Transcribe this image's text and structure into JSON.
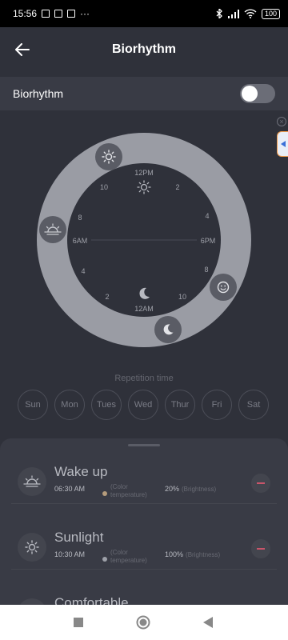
{
  "status_bar": {
    "time": "15:56",
    "extra": "···",
    "battery": "100"
  },
  "header": {
    "title": "Biorhythm"
  },
  "biorhythm_toggle": {
    "label": "Biorhythm",
    "on": false
  },
  "dial": {
    "top_label": "12PM",
    "bottom_label": "12AM",
    "left_label": "6AM",
    "right_label": "6PM",
    "hour_left_top": "10",
    "hour_right_top": "2",
    "hour_left_mid": "8",
    "hour_right_mid": "4",
    "hour_left_low": "4",
    "hour_right_low": "8",
    "hour_left_bottom": "2",
    "hour_right_bottom": "10"
  },
  "repetition": {
    "title": "Repetition time",
    "days": [
      "Sun",
      "Mon",
      "Tues",
      "Wed",
      "Thur",
      "Fri",
      "Sat"
    ]
  },
  "modes": [
    {
      "name": "Wake up",
      "time": "06:30 AM",
      "color_temperature_label": "(Color temperature)",
      "color_temperature_color": "#b59c7c",
      "brightness": "20%",
      "brightness_label": "(Brightness)",
      "icon": "sunrise-icon"
    },
    {
      "name": "Sunlight",
      "time": "10:30 AM",
      "color_temperature_label": "(Color temperature)",
      "color_temperature_color": "#9da0a8",
      "brightness": "100%",
      "brightness_label": "(Brightness)",
      "icon": "sun-icon"
    },
    {
      "name": "Comfortable",
      "time": "",
      "color_temperature_label": "",
      "color_temperature_color": "#9da0a8",
      "brightness": "",
      "brightness_label": "",
      "icon": "sunset-icon"
    }
  ],
  "colors": {
    "background": "#2f313a",
    "ring": "#9a9ca4",
    "accent_remove": "#c9556a",
    "side_tab_border": "#f09a4a"
  }
}
